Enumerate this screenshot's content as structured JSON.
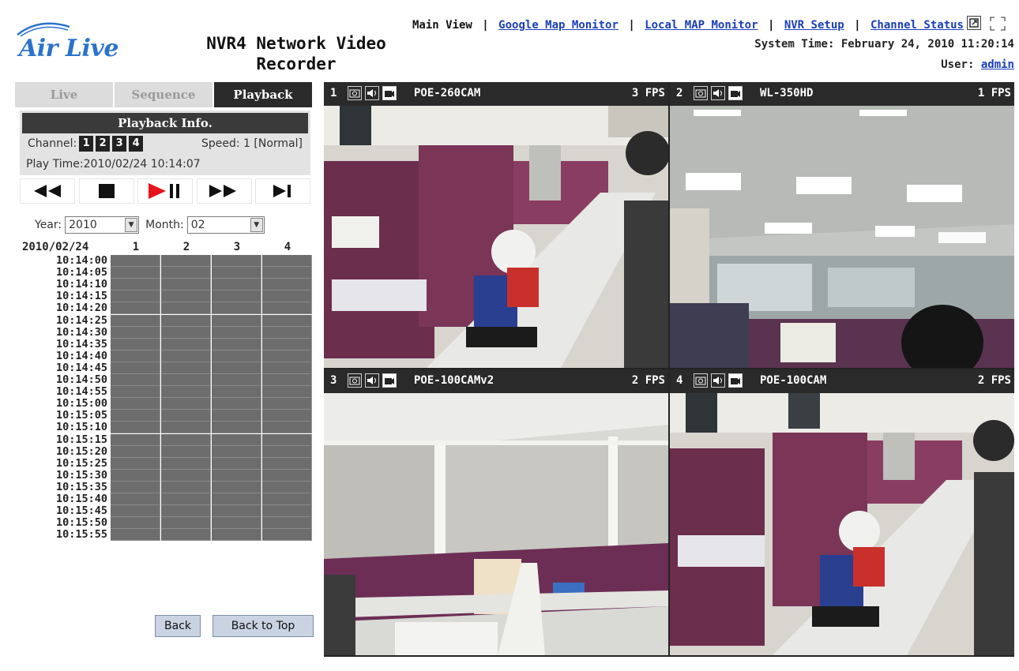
{
  "brand": {
    "logo_text": "Air Live"
  },
  "app_title": "NVR4 Network Video Recorder",
  "nav": {
    "main_view": "Main View",
    "google_map": "Google Map Monitor",
    "local_map": "Local MAP Monitor",
    "nvr_setup": "NVR Setup",
    "channel_status": "Channel Status",
    "separator": "|"
  },
  "system_time": "System Time: February 24, 2010 11:20:14",
  "user": {
    "label": "User:",
    "name": "admin"
  },
  "tabs": [
    {
      "label": "Live",
      "active": false
    },
    {
      "label": "Sequence",
      "active": false
    },
    {
      "label": "Playback",
      "active": true
    }
  ],
  "playback_info": {
    "title": "Playback Info.",
    "channel_label": "Channel:",
    "channels": [
      "1",
      "2",
      "3",
      "4"
    ],
    "speed": "Speed: 1 [Normal]",
    "play_time": "Play Time:2010/02/24 10:14:07"
  },
  "controls": [
    "rewind",
    "stop",
    "play-pause",
    "fast-forward",
    "next-frame"
  ],
  "date_select": {
    "year_label": "Year:",
    "year": "2010",
    "month_label": "Month:",
    "month": "02"
  },
  "timeline": {
    "date": "2010/02/24",
    "columns": [
      "1",
      "2",
      "3",
      "4"
    ],
    "times": [
      "10:14:00",
      "10:14:05",
      "10:14:10",
      "10:14:15",
      "10:14:20",
      "10:14:25",
      "10:14:30",
      "10:14:35",
      "10:14:40",
      "10:14:45",
      "10:14:50",
      "10:14:55",
      "10:15:00",
      "10:15:05",
      "10:15:10",
      "10:15:15",
      "10:15:20",
      "10:15:25",
      "10:15:30",
      "10:15:35",
      "10:15:40",
      "10:15:45",
      "10:15:50",
      "10:15:55"
    ]
  },
  "buttons": {
    "back": "Back",
    "back_to_top": "Back to Top"
  },
  "cameras": [
    {
      "num": "1",
      "name": "POE-260CAM",
      "fps": "3 FPS"
    },
    {
      "num": "2",
      "name": "WL-350HD",
      "fps": "1 FPS"
    },
    {
      "num": "3",
      "name": "POE-100CAMv2",
      "fps": "2 FPS"
    },
    {
      "num": "4",
      "name": "POE-100CAM",
      "fps": "2 FPS"
    }
  ],
  "colors": {
    "link": "#1a3fb8",
    "brand": "#2a73c9",
    "play_red": "#e8141c",
    "grid_bg": "#232323"
  }
}
